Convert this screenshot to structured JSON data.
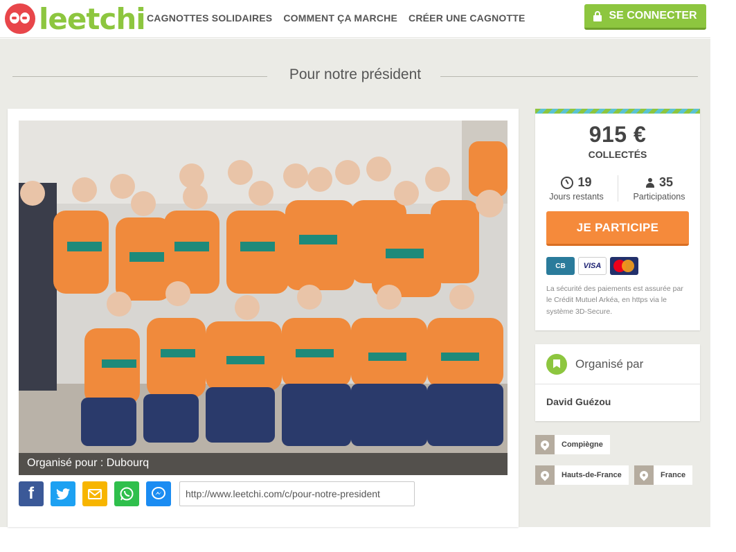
{
  "header": {
    "brand": "leetchi",
    "nav": [
      "CAGNOTTES SOLIDAIRES",
      "COMMENT ÇA MARCHE",
      "CRÉER UNE CAGNOTTE"
    ],
    "login_label": "SE CONNECTER"
  },
  "page": {
    "title": "Pour notre président"
  },
  "photo": {
    "caption": "Organisé pour : Dubourq"
  },
  "share": {
    "url": "http://www.leetchi.com/c/pour-notre-president",
    "icons": [
      "facebook-icon",
      "twitter-icon",
      "email-icon",
      "whatsapp-icon",
      "messenger-icon"
    ]
  },
  "funds": {
    "amount": "915 €",
    "collected_label": "COLLECTÉS",
    "days_left": "19",
    "days_left_label": "Jours restants",
    "participants": "35",
    "participants_label": "Participations",
    "participate_label": "JE PARTICIPE",
    "payment_methods": [
      "CB",
      "VISA",
      "MasterCard"
    ],
    "security_text": "La sécurité des paiements est assurée par le Crédit Mutuel Arkéa, en https via le système 3D-Secure."
  },
  "organizer": {
    "title": "Organisé par",
    "name": "David Guézou"
  },
  "locations": [
    "Compiègne",
    "Hauts-de-France",
    "France"
  ],
  "colors": {
    "brand_green": "#8dc63f",
    "brand_red": "#e8464a",
    "participate_orange": "#f58a3b",
    "background": "#ebebe6"
  }
}
